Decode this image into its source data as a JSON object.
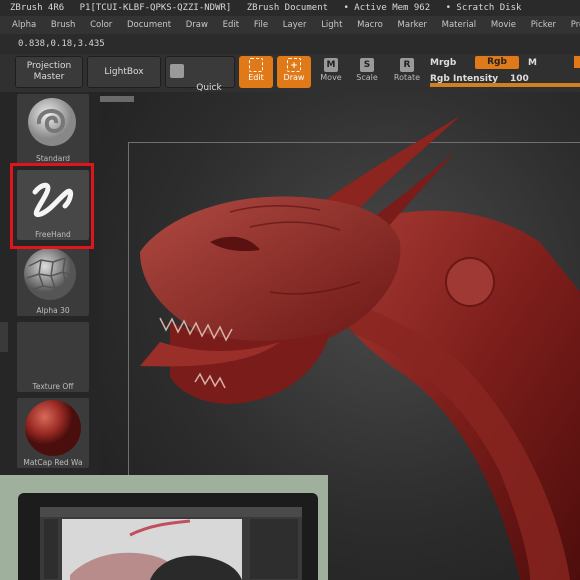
{
  "titlebar": {
    "app": "ZBrush 4R6",
    "build": "P1[TCUI-KLBF-QPKS-QZZI-NDWR]",
    "document": "ZBrush Document",
    "mem": "• Active Mem 962",
    "scratch": "• Scratch Disk"
  },
  "menu": [
    "Alpha",
    "Brush",
    "Color",
    "Document",
    "Draw",
    "Edit",
    "File",
    "Layer",
    "Light",
    "Macro",
    "Marker",
    "Material",
    "Movie",
    "Picker",
    "Preferences"
  ],
  "coords": "0.838,0.18,3.435",
  "toolbar": {
    "projection_master": "Projection\nMaster",
    "lightbox": "LightBox",
    "quick_sketch": "Quick\nSketch",
    "edit": "Edit",
    "draw": "Draw",
    "move": "Move",
    "scale": "Scale",
    "rotate": "Rotate",
    "move_glyph": "M",
    "scale_glyph": "S",
    "rotate_glyph": "R",
    "mrgb": "Mrgb",
    "rgb": "Rgb",
    "m": "M",
    "rgb_intensity_label": "Rgb Intensity",
    "rgb_intensity_value": "100"
  },
  "rgb_intensity_fraction": 1.0,
  "left_panel": {
    "items": [
      {
        "caption": "Standard"
      },
      {
        "caption": "FreeHand"
      },
      {
        "caption": "Alpha 30"
      },
      {
        "caption": "Texture Off"
      },
      {
        "caption": "MatCap Red Wa"
      }
    ]
  },
  "colors": {
    "accent": "#e07a18",
    "highlight_box": "#e0141a",
    "sculpt": "#8c1f1f"
  }
}
